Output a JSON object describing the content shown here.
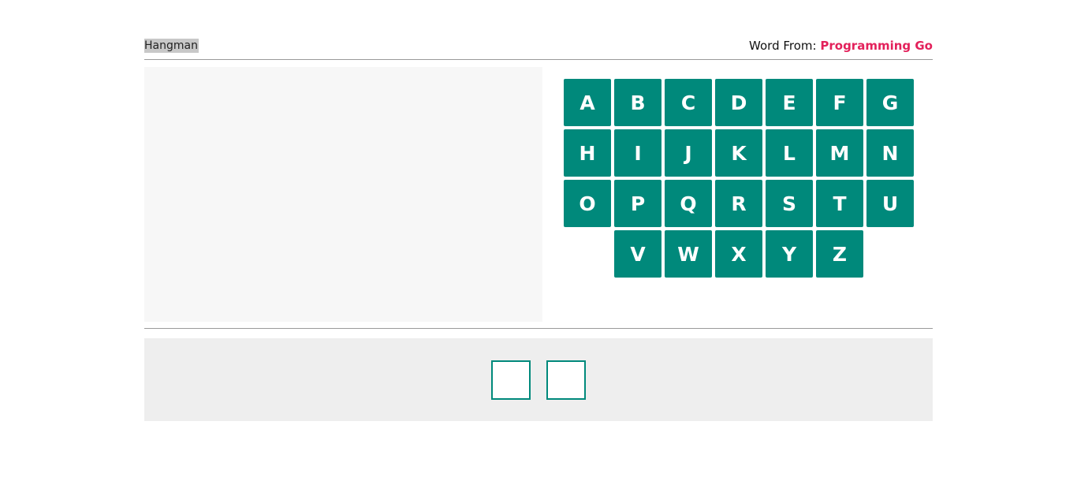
{
  "header": {
    "title": "Hangman",
    "word_from_label": "Word From:",
    "category": "Programming Go"
  },
  "keyboard": {
    "rows": [
      [
        "A",
        "B",
        "C",
        "D",
        "E",
        "F",
        "G"
      ],
      [
        "H",
        "I",
        "J",
        "K",
        "L",
        "M",
        "N"
      ],
      [
        "O",
        "P",
        "Q",
        "R",
        "S",
        "T",
        "U"
      ],
      [
        "V",
        "W",
        "X",
        "Y",
        "Z"
      ]
    ]
  },
  "word": {
    "letter_count": 2,
    "revealed": [
      "",
      ""
    ]
  },
  "colors": {
    "key_background": "#00897b",
    "category_text": "#e3215b",
    "word_panel_background": "#eeeeee",
    "drawing_background": "#f7f7f7"
  }
}
